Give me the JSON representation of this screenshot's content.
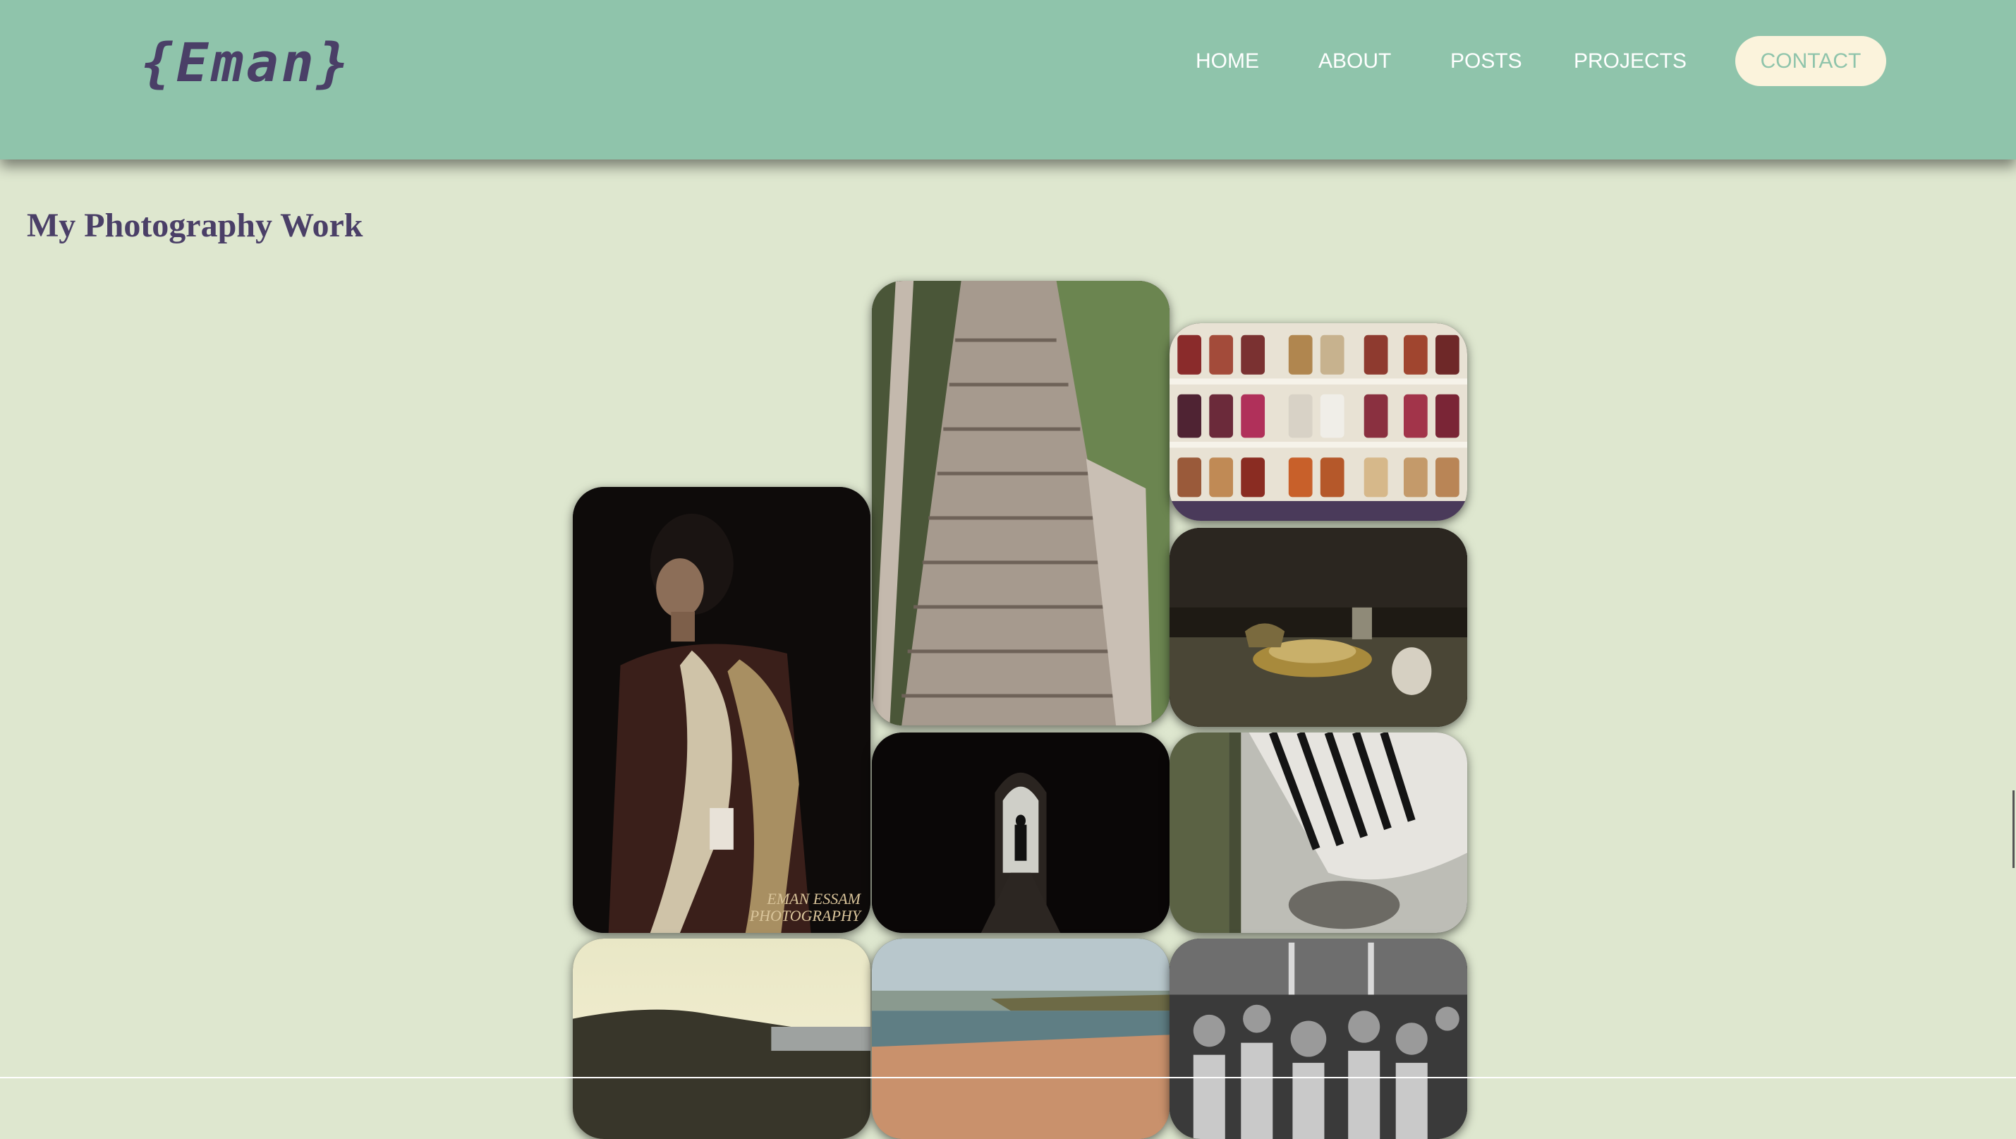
{
  "header": {
    "logo": "{Eman}",
    "nav": [
      {
        "label": "HOME"
      },
      {
        "label": "ABOUT"
      },
      {
        "label": "POSTS"
      },
      {
        "label": "PROJECTS"
      }
    ],
    "contact_label": "CONTACT"
  },
  "main": {
    "title": "My Photography Work",
    "photos": [
      {
        "subject": "boardwalk stairs"
      },
      {
        "subject": "jar shelves"
      },
      {
        "subject": "woman in sari",
        "watermark_line1": "EMAN ESSAM",
        "watermark_line2": "PHOTOGRAPHY"
      },
      {
        "subject": "tea table"
      },
      {
        "subject": "tunnel silhouette"
      },
      {
        "subject": "zebra"
      },
      {
        "subject": "coastal sunset"
      },
      {
        "subject": "beach"
      },
      {
        "subject": "crowd waving"
      }
    ]
  },
  "colors": {
    "header_bg": "#8fc4ab",
    "page_bg": "#dee7cf",
    "accent_text": "#4a3f67",
    "contact_bg": "#fbf3dc"
  }
}
